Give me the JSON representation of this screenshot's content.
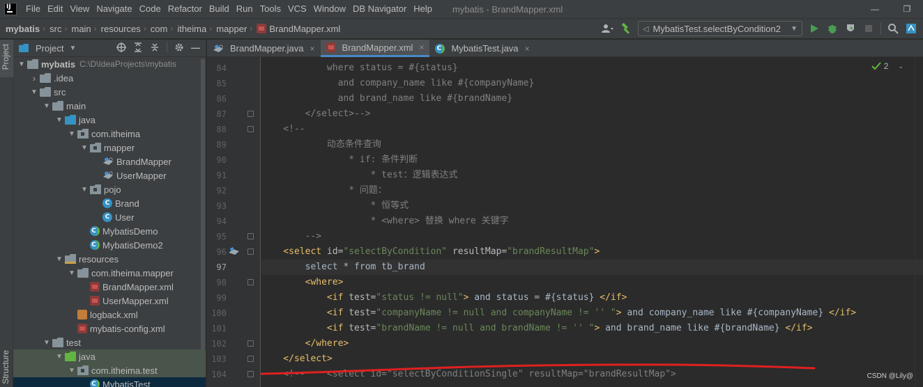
{
  "menubar": {
    "items": [
      "File",
      "Edit",
      "View",
      "Navigate",
      "Code",
      "Refactor",
      "Build",
      "Run",
      "Tools",
      "VCS",
      "Window",
      "DB Navigator",
      "Help"
    ],
    "window_title": "mybatis - BrandMapper.xml",
    "minimize": "—",
    "restore": "❐"
  },
  "breadcrumbs": [
    "mybatis",
    "src",
    "main",
    "resources",
    "com",
    "itheima",
    "mapper",
    "BrandMapper.xml"
  ],
  "run_config": "MybatisTest.selectByCondition2",
  "left_stripe": {
    "project_label": "Project",
    "structure_label": "Structure"
  },
  "project_panel": {
    "title": "Project",
    "tree": [
      {
        "label": "mybatis",
        "path": "C:\\D\\IdeaProjects\\mybatis",
        "depth": 0,
        "arrow": "▾",
        "icon": "folder",
        "bold": true
      },
      {
        "label": ".idea",
        "depth": 1,
        "arrow": "›",
        "icon": "folder"
      },
      {
        "label": "src",
        "depth": 1,
        "arrow": "▾",
        "icon": "folder"
      },
      {
        "label": "main",
        "depth": 2,
        "arrow": "▾",
        "icon": "folder"
      },
      {
        "label": "java",
        "depth": 3,
        "arrow": "▾",
        "icon": "folder-blue"
      },
      {
        "label": "com.itheima",
        "depth": 4,
        "arrow": "▾",
        "icon": "package"
      },
      {
        "label": "mapper",
        "depth": 5,
        "arrow": "▾",
        "icon": "package"
      },
      {
        "label": "BrandMapper",
        "depth": 6,
        "arrow": "",
        "icon": "mapper"
      },
      {
        "label": "UserMapper",
        "depth": 6,
        "arrow": "",
        "icon": "mapper"
      },
      {
        "label": "pojo",
        "depth": 5,
        "arrow": "▾",
        "icon": "package"
      },
      {
        "label": "Brand",
        "depth": 6,
        "arrow": "",
        "icon": "class"
      },
      {
        "label": "User",
        "depth": 6,
        "arrow": "",
        "icon": "class"
      },
      {
        "label": "MybatisDemo",
        "depth": 5,
        "arrow": "",
        "icon": "class-g"
      },
      {
        "label": "MybatisDemo2",
        "depth": 5,
        "arrow": "",
        "icon": "class-g"
      },
      {
        "label": "resources",
        "depth": 3,
        "arrow": "▾",
        "icon": "folder-res"
      },
      {
        "label": "com.itheima.mapper",
        "depth": 4,
        "arrow": "▾",
        "icon": "folder"
      },
      {
        "label": "BrandMapper.xml",
        "depth": 5,
        "arrow": "",
        "icon": "xml"
      },
      {
        "label": "UserMapper.xml",
        "depth": 5,
        "arrow": "",
        "icon": "xml"
      },
      {
        "label": "logback.xml",
        "depth": 4,
        "arrow": "",
        "icon": "logback"
      },
      {
        "label": "mybatis-config.xml",
        "depth": 4,
        "arrow": "",
        "icon": "xml"
      },
      {
        "label": "test",
        "depth": 2,
        "arrow": "▾",
        "icon": "folder"
      },
      {
        "label": "java",
        "depth": 3,
        "arrow": "▾",
        "icon": "folder-green",
        "highlight": true
      },
      {
        "label": "com.itheima.test",
        "depth": 4,
        "arrow": "▾",
        "icon": "package",
        "highlight": true
      },
      {
        "label": "MybatisTest",
        "depth": 5,
        "arrow": "",
        "icon": "class-g",
        "selected": true
      }
    ]
  },
  "tabs": [
    {
      "label": "BrandMapper.java",
      "icon": "mapper",
      "active": false
    },
    {
      "label": "BrandMapper.xml",
      "icon": "xml",
      "active": true
    },
    {
      "label": "MybatisTest.java",
      "icon": "class-g",
      "active": false
    }
  ],
  "inspection_count": "2",
  "code": [
    {
      "n": "84",
      "segs": [
        [
          "            where status = #{status}",
          "comment"
        ]
      ]
    },
    {
      "n": "85",
      "segs": [
        [
          "              and company_name like #{companyName}",
          "comment"
        ]
      ]
    },
    {
      "n": "86",
      "segs": [
        [
          "              and brand_name like #{brandName}",
          "comment"
        ]
      ]
    },
    {
      "n": "87",
      "segs": [
        [
          "        </select>-->",
          "comment"
        ]
      ]
    },
    {
      "n": "88",
      "segs": [
        [
          "    <!--",
          "comment"
        ]
      ]
    },
    {
      "n": "89",
      "segs": [
        [
          "            动态条件查询",
          "comment"
        ]
      ]
    },
    {
      "n": "90",
      "segs": [
        [
          "                * if: 条件判断",
          "comment"
        ]
      ]
    },
    {
      "n": "91",
      "segs": [
        [
          "                    * test：逻辑表达式",
          "comment"
        ]
      ]
    },
    {
      "n": "92",
      "segs": [
        [
          "                * 问题：",
          "comment"
        ]
      ]
    },
    {
      "n": "93",
      "segs": [
        [
          "                    * 恒等式",
          "comment"
        ]
      ]
    },
    {
      "n": "94",
      "segs": [
        [
          "                    * <where> 替换 where 关键字",
          "comment"
        ]
      ]
    },
    {
      "n": "95",
      "segs": [
        [
          "        -->",
          "comment"
        ]
      ]
    },
    {
      "n": "96",
      "segs": [
        [
          "    <select ",
          "tag"
        ],
        [
          "id=",
          "attr"
        ],
        [
          "\"selectByCondition\"",
          "val"
        ],
        [
          " resultMap=",
          "attr"
        ],
        [
          "\"brandResultMap\"",
          "val"
        ],
        [
          ">",
          "tag"
        ]
      ]
    },
    {
      "n": "97",
      "segs": [
        [
          "        select * from tb_brand",
          "plain"
        ]
      ],
      "current": true
    },
    {
      "n": "98",
      "segs": [
        [
          "        <where>",
          "tag"
        ]
      ]
    },
    {
      "n": "99",
      "segs": [
        [
          "            <if ",
          "tag"
        ],
        [
          "test=",
          "attr"
        ],
        [
          "\"status != null\"",
          "val"
        ],
        [
          ">",
          "tag"
        ],
        [
          " and status = #{status} ",
          "plain"
        ],
        [
          "</if>",
          "tag"
        ]
      ]
    },
    {
      "n": "100",
      "segs": [
        [
          "            <if ",
          "tag"
        ],
        [
          "test=",
          "attr"
        ],
        [
          "\"companyName != null and companyName != '' \"",
          "val"
        ],
        [
          ">",
          "tag"
        ],
        [
          " and company_name like #{companyName} ",
          "plain"
        ],
        [
          "</if>",
          "tag"
        ]
      ]
    },
    {
      "n": "101",
      "segs": [
        [
          "            <if ",
          "tag"
        ],
        [
          "test=",
          "attr"
        ],
        [
          "\"brandName != null and brandName != '' \"",
          "val"
        ],
        [
          ">",
          "tag"
        ],
        [
          " and brand_name like #{brandName} ",
          "plain"
        ],
        [
          "</if>",
          "tag"
        ]
      ]
    },
    {
      "n": "102",
      "segs": [
        [
          "        </where>",
          "tag"
        ]
      ]
    },
    {
      "n": "103",
      "segs": [
        [
          "    </select>",
          "tag"
        ]
      ]
    },
    {
      "n": "104",
      "segs": [
        [
          "    <!--    <select id=\"selectByConditionSingle\" resultMap=\"brandResultMap\">",
          "comment"
        ]
      ]
    }
  ],
  "fold_lines": [
    "87",
    "88",
    "95",
    "96",
    "98",
    "102",
    "103",
    "104"
  ],
  "watermark": "CSDN @Lily@",
  "colors": {
    "tag": "#e8bf6a",
    "attr": "#bababa",
    "val": "#6a8759",
    "comment": "#808080",
    "plain": "#a9b7c6",
    "accent": "#4a88c7",
    "annotation_stroke": "#e02020"
  }
}
